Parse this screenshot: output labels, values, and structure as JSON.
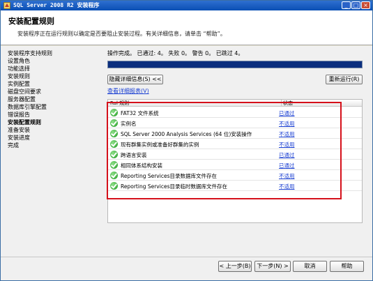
{
  "window": {
    "title": "SQL Server 2008 R2 安装程序",
    "icon": "sql-server-setup-icon",
    "controls": [
      "minimize-icon",
      "maximize-icon",
      "close-icon"
    ]
  },
  "header": {
    "title": "安装配置规则",
    "subtitle": "安装程序正在运行规则以确定是否要阻止安装过程。有关详细信息，请单击 “帮助”。"
  },
  "steps": [
    {
      "label": "安装程序支持规则",
      "current": false
    },
    {
      "label": "设置角色",
      "current": false
    },
    {
      "label": "功能选择",
      "current": false
    },
    {
      "label": "安装规则",
      "current": false
    },
    {
      "label": "实例配置",
      "current": false
    },
    {
      "label": "磁盘空间要求",
      "current": false
    },
    {
      "label": "服务器配置",
      "current": false
    },
    {
      "label": "数据库引擎配置",
      "current": false
    },
    {
      "label": "错误报告",
      "current": false
    },
    {
      "label": "安装配置规则",
      "current": true
    },
    {
      "label": "准备安装",
      "current": false
    },
    {
      "label": "安装进度",
      "current": false
    },
    {
      "label": "完成",
      "current": false
    }
  ],
  "main": {
    "status_line": "操作完成。 已通过: 4。 失败 0。 警告 0。 已跳过 4。",
    "progress_percent": 100,
    "hide_details_button": "隐藏详细信息(S) <<",
    "rerun_button": "重新运行(R)",
    "view_report_link": "查看详细报表(V)",
    "table": {
      "columns": [
        "Rul",
        "规则",
        "状态"
      ],
      "rows": [
        {
          "rule": "FAT32 文件系统",
          "status": "已通过",
          "icon": "check-icon"
        },
        {
          "rule": "实例名",
          "status": "不适用",
          "icon": "check-icon"
        },
        {
          "rule": "SQL Server 2000 Analysis Services (64 位)安装操作",
          "status": "不适用",
          "icon": "check-icon"
        },
        {
          "rule": "现有群集实例或准备好群集的实例",
          "status": "不适用",
          "icon": "check-icon"
        },
        {
          "rule": "跨语言安装",
          "status": "已通过",
          "icon": "check-icon"
        },
        {
          "rule": "相同体系结构安装",
          "status": "已通过",
          "icon": "check-icon"
        },
        {
          "rule": "Reporting Services目录数据库文件存在",
          "status": "不适用",
          "icon": "check-icon"
        },
        {
          "rule": "Reporting Services目录临时数据库文件存在",
          "status": "不适用",
          "icon": "check-icon"
        }
      ]
    }
  },
  "footer": {
    "back": "< 上一步(B)",
    "next": "下一步(N) >",
    "cancel": "取消",
    "help": "帮助"
  },
  "colors": {
    "titlebar": "#0a4fb4",
    "progress": "#0b2e7e",
    "link": "#1a3fd2",
    "highlight": "#d5101a",
    "check": "#1e9a1e"
  }
}
